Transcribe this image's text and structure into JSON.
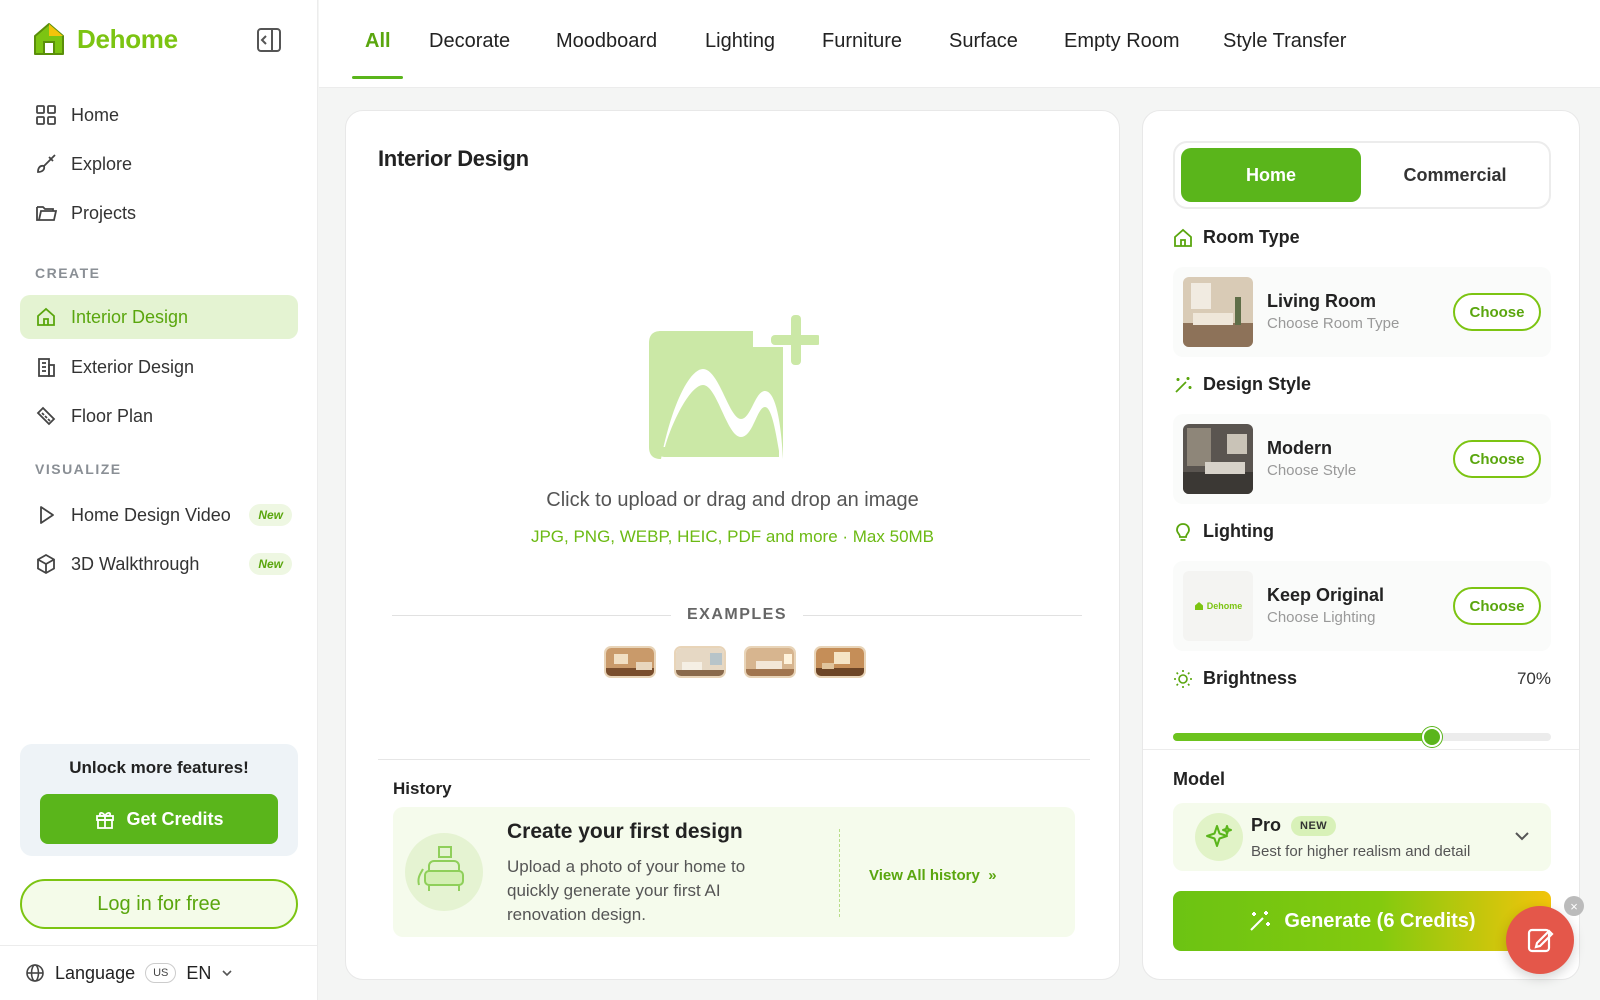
{
  "brand": {
    "name": "Dehome",
    "color": "#7cc412"
  },
  "sidebar": {
    "nav": [
      {
        "label": "Home",
        "icon": "grid-icon"
      },
      {
        "label": "Explore",
        "icon": "brush-icon"
      },
      {
        "label": "Projects",
        "icon": "folder-icon"
      }
    ],
    "create_label": "CREATE",
    "create": [
      {
        "label": "Interior Design",
        "icon": "house-icon",
        "active": true
      },
      {
        "label": "Exterior Design",
        "icon": "building-icon"
      },
      {
        "label": "Floor Plan",
        "icon": "ruler-icon"
      }
    ],
    "visualize_label": "VISUALIZE",
    "visualize": [
      {
        "label": "Home Design Video",
        "icon": "play-icon",
        "badge": "New"
      },
      {
        "label": "3D Walkthrough",
        "icon": "cube-icon",
        "badge": "New"
      }
    ],
    "promo": {
      "title": "Unlock more features!",
      "button": "Get Credits"
    },
    "login": "Log in for free",
    "language": {
      "label": "Language",
      "code": "US",
      "value": "EN"
    }
  },
  "tabs": {
    "items": [
      "All",
      "Decorate",
      "Moodboard",
      "Lighting",
      "Furniture",
      "Surface",
      "Empty Room",
      "Style Transfer"
    ],
    "active": "All"
  },
  "main": {
    "title": "Interior Design",
    "upload_text": "Click to upload or drag and drop an image",
    "upload_hint": "JPG, PNG, WEBP, HEIC, PDF and more · Max 50MB",
    "examples_label": "EXAMPLES",
    "history": {
      "label": "History",
      "title": "Create your first design",
      "description": "Upload a photo of your home to quickly generate your first AI renovation design.",
      "link": "View All history",
      "link_arrow": "»"
    }
  },
  "panel": {
    "segments": [
      "Home",
      "Commercial"
    ],
    "active_segment": "Home",
    "room_type": {
      "heading": "Room Type",
      "value": "Living Room",
      "sub": "Choose Room Type",
      "button": "Choose"
    },
    "design_style": {
      "heading": "Design Style",
      "value": "Modern",
      "sub": "Choose Style",
      "button": "Choose"
    },
    "lighting": {
      "heading": "Lighting",
      "value": "Keep Original",
      "sub": "Choose Lighting",
      "button": "Choose",
      "thumb_text": "Dehome"
    },
    "brightness": {
      "heading": "Brightness",
      "display": "70%",
      "value": 0.7
    },
    "model": {
      "heading": "Model",
      "name": "Pro",
      "badge": "NEW",
      "description": "Best for higher realism and detail"
    },
    "generate": "Generate (6 Credits)"
  },
  "fab": {
    "close": "×"
  },
  "colors": {
    "accent": "#5ab51b",
    "accent_light": "#e4f3d2",
    "upload_icon": "#cbe8a6",
    "fab": "#e4574a"
  }
}
